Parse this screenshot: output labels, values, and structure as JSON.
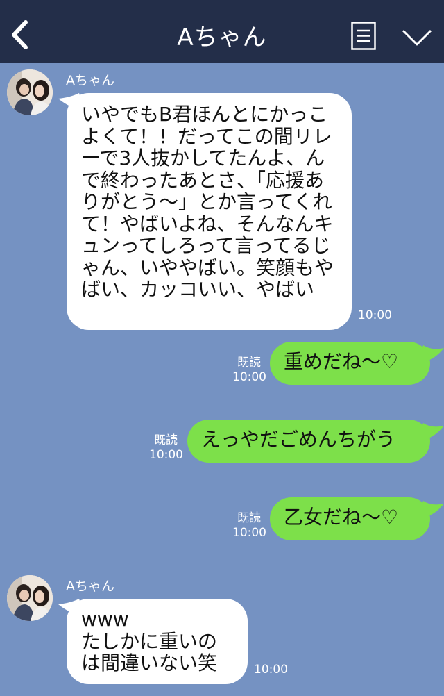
{
  "header": {
    "title": "Aちゃん",
    "back_icon": "chevron-left-icon",
    "menu_icon": "menu-lines-icon",
    "collapse_icon": "chevron-down-icon",
    "background": "#232e49"
  },
  "chat": {
    "background": "#7592c2",
    "incoming_color": "#ffffff",
    "outgoing_color": "#7de04a",
    "messages": [
      {
        "direction": "in",
        "sender": "Aちゃん",
        "text": "いやでもB君ほんとにかっこよくて！！だってこの間リレーで3人抜かしてたんよ、んで終わったあとさ、「応援ありがとう〜」とか言ってくれて！やばいよね、そんなんキュンってしろって言ってるじゃん、いややばい。笑顔もやばい、カッコいい、やばい",
        "time": "10:00"
      },
      {
        "direction": "out",
        "text": "重めだね〜♡",
        "read": "既読",
        "time": "10:00"
      },
      {
        "direction": "out",
        "text": "えっやだごめんちがう",
        "read": "既読",
        "time": "10:00"
      },
      {
        "direction": "out",
        "text": "乙女だね〜♡",
        "read": "既読",
        "time": "10:00"
      },
      {
        "direction": "in",
        "sender": "Aちゃん",
        "text": "www\nたしかに重いのは間違いない笑",
        "time": "10:00"
      }
    ]
  }
}
